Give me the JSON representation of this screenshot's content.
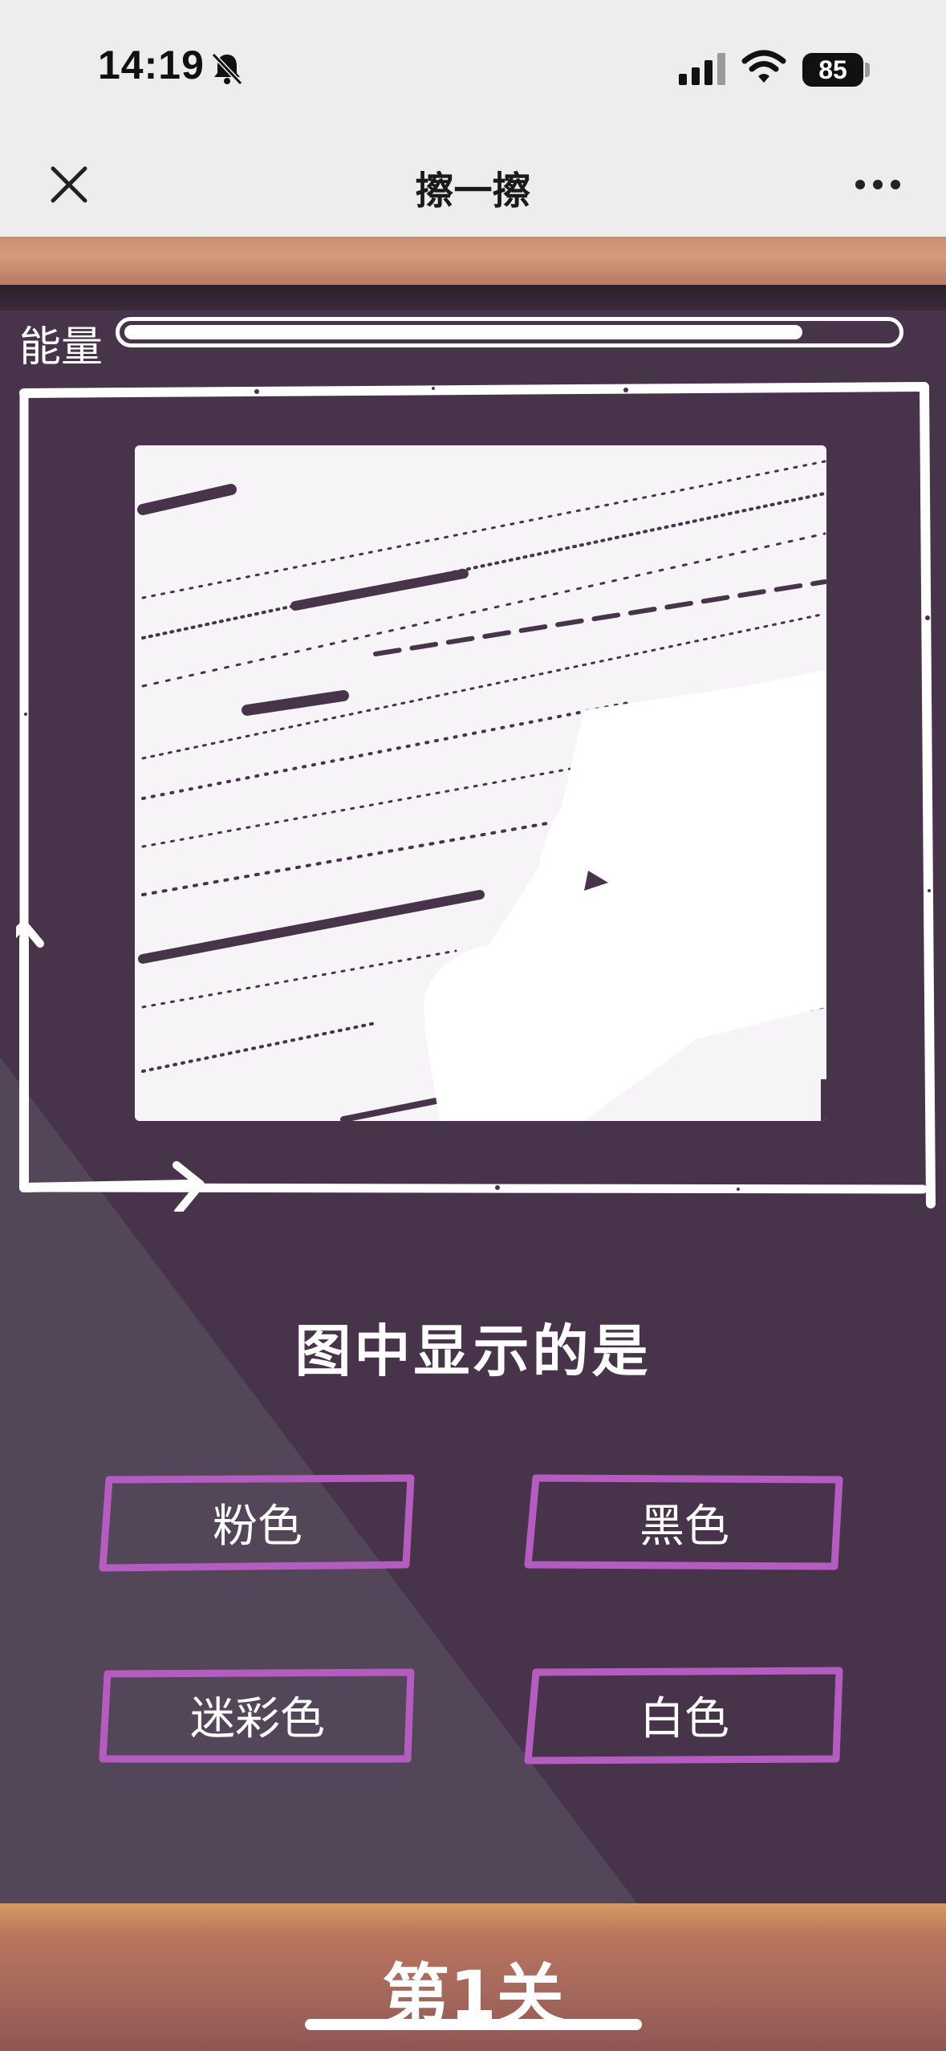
{
  "status_bar": {
    "time": "14:19",
    "battery": "85",
    "icons": [
      "bell-muted-icon",
      "signal-icon",
      "wifi-icon",
      "battery-icon"
    ]
  },
  "nav": {
    "title": "擦一擦",
    "close_icon": "close-icon",
    "more_icon": "more-icon"
  },
  "game": {
    "energy_label": "能量",
    "energy_level": 0.88,
    "question": "图中显示的是",
    "options": [
      "粉色",
      "黑色",
      "迷彩色",
      "白色"
    ],
    "level": "第1关"
  },
  "colors": {
    "board": "#47344A",
    "option_border": "#B45CC0",
    "chalk": "#FFFFFF"
  }
}
